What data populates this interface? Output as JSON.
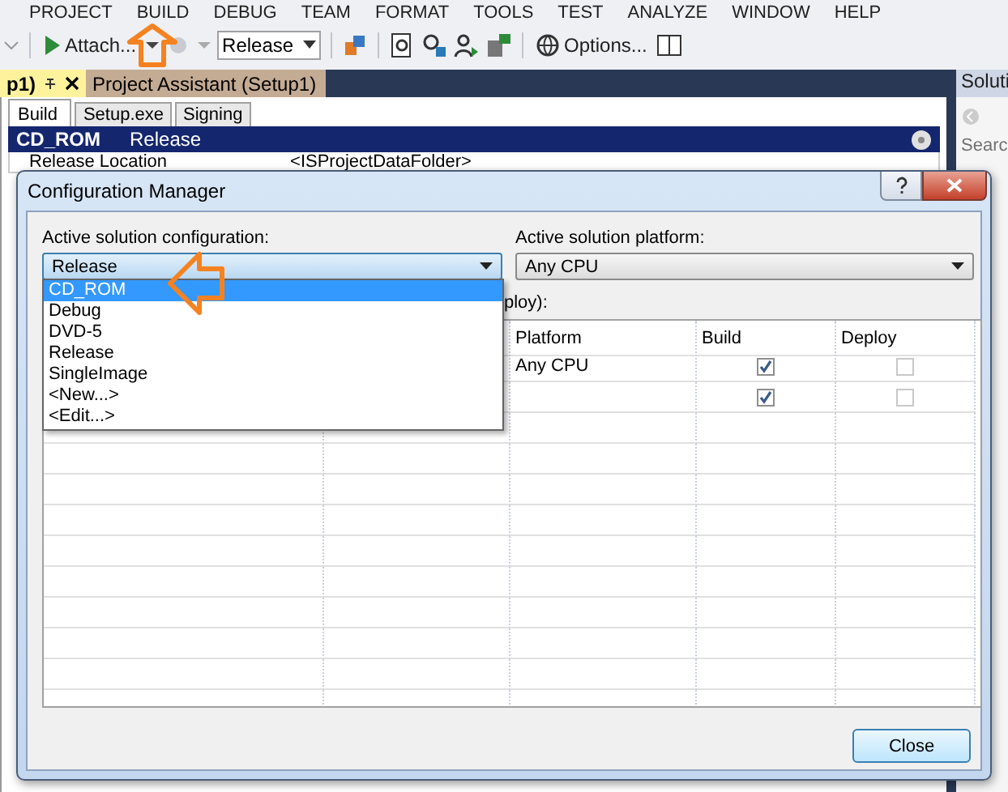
{
  "menu": [
    {
      "label": "PROJECT"
    },
    {
      "label": "BUILD"
    },
    {
      "label": "DEBUG"
    },
    {
      "label": "TEAM"
    },
    {
      "label": "FORMAT"
    },
    {
      "label": "TOOLS"
    },
    {
      "label": "TEST"
    },
    {
      "label": "ANALYZE"
    },
    {
      "label": "WINDOW"
    },
    {
      "label": "HELP"
    }
  ],
  "toolbar": {
    "attach": "Attach...",
    "configuration": "Release",
    "options": "Options..."
  },
  "document_tabs": [
    {
      "label": "p1)",
      "selected": true
    },
    {
      "label": "Project Assistant (Setup1)",
      "selected": false
    }
  ],
  "inner_tabs": [
    {
      "label": "Build",
      "selected": true
    },
    {
      "label": "Setup.exe",
      "selected": false
    },
    {
      "label": "Signing",
      "selected": false
    }
  ],
  "header": {
    "name": "CD_ROM",
    "configuration": "Release"
  },
  "property_row": {
    "name": "Release Location",
    "value": "<ISProjectDataFolder>"
  },
  "side_panel": {
    "title": "Soluti",
    "search_placeholder": "Searc"
  },
  "dialog": {
    "title": "Configuration Manager",
    "config_label": "Active solution configuration:",
    "config_value": "Release",
    "configurations": [
      {
        "label": "CD_ROM",
        "selected": true
      },
      {
        "label": "Debug",
        "selected": false
      },
      {
        "label": "DVD-5",
        "selected": false
      },
      {
        "label": "Release",
        "selected": false
      },
      {
        "label": "SingleImage",
        "selected": false
      },
      {
        "label": "<New...>",
        "selected": false
      },
      {
        "label": "<Edit...>",
        "selected": false
      }
    ],
    "platform_label": "Active solution platform:",
    "platform_value": "Any CPU",
    "grid_label": "ploy):",
    "columns": [
      "Platform",
      "Build",
      "Deploy"
    ],
    "rows": [
      {
        "platform": "Any CPU",
        "build": {
          "checked": true,
          "disabled": false
        },
        "deploy": {
          "checked": false,
          "disabled": true
        }
      },
      {
        "build": {
          "checked": true,
          "disabled": false
        },
        "deploy": {
          "checked": false,
          "disabled": true
        }
      }
    ],
    "close_button": "Close"
  }
}
